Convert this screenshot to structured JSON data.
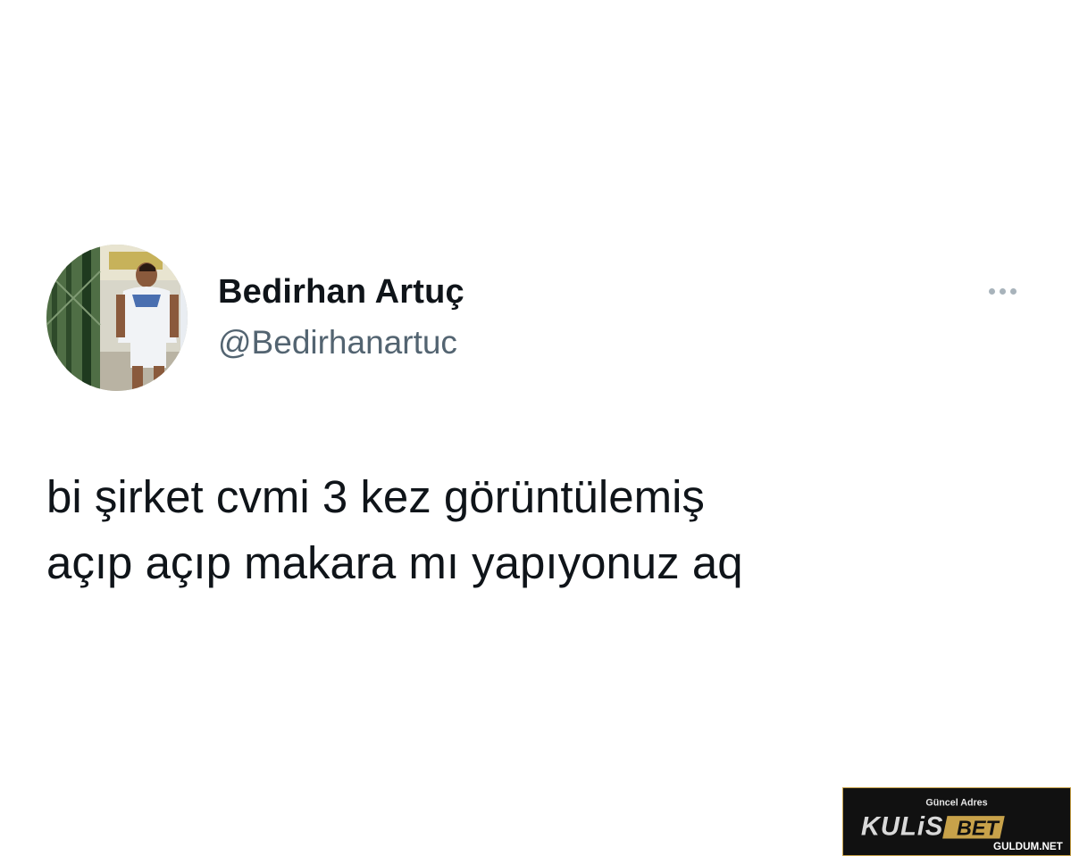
{
  "tweet": {
    "display_name": "Bedirhan Artuç",
    "handle": "@Bedirhanartuc",
    "text_lines": [
      "bi şirket cvmi 3 kez görüntülemiş",
      "açıp açıp makara mı yapıyonuz aq"
    ],
    "more_icon": "more-horizontal-icon"
  },
  "watermark": {
    "top_text": "Güncel Adres",
    "brand_left": "KULiS",
    "brand_right": "BET",
    "site": "GULDUM.NET"
  },
  "colors": {
    "background": "#ffffff",
    "text_primary": "#0f1419",
    "text_secondary": "#536471",
    "dots": "#a8b3bb",
    "watermark_bg": "#111111",
    "watermark_gold": "#c8a24a"
  }
}
